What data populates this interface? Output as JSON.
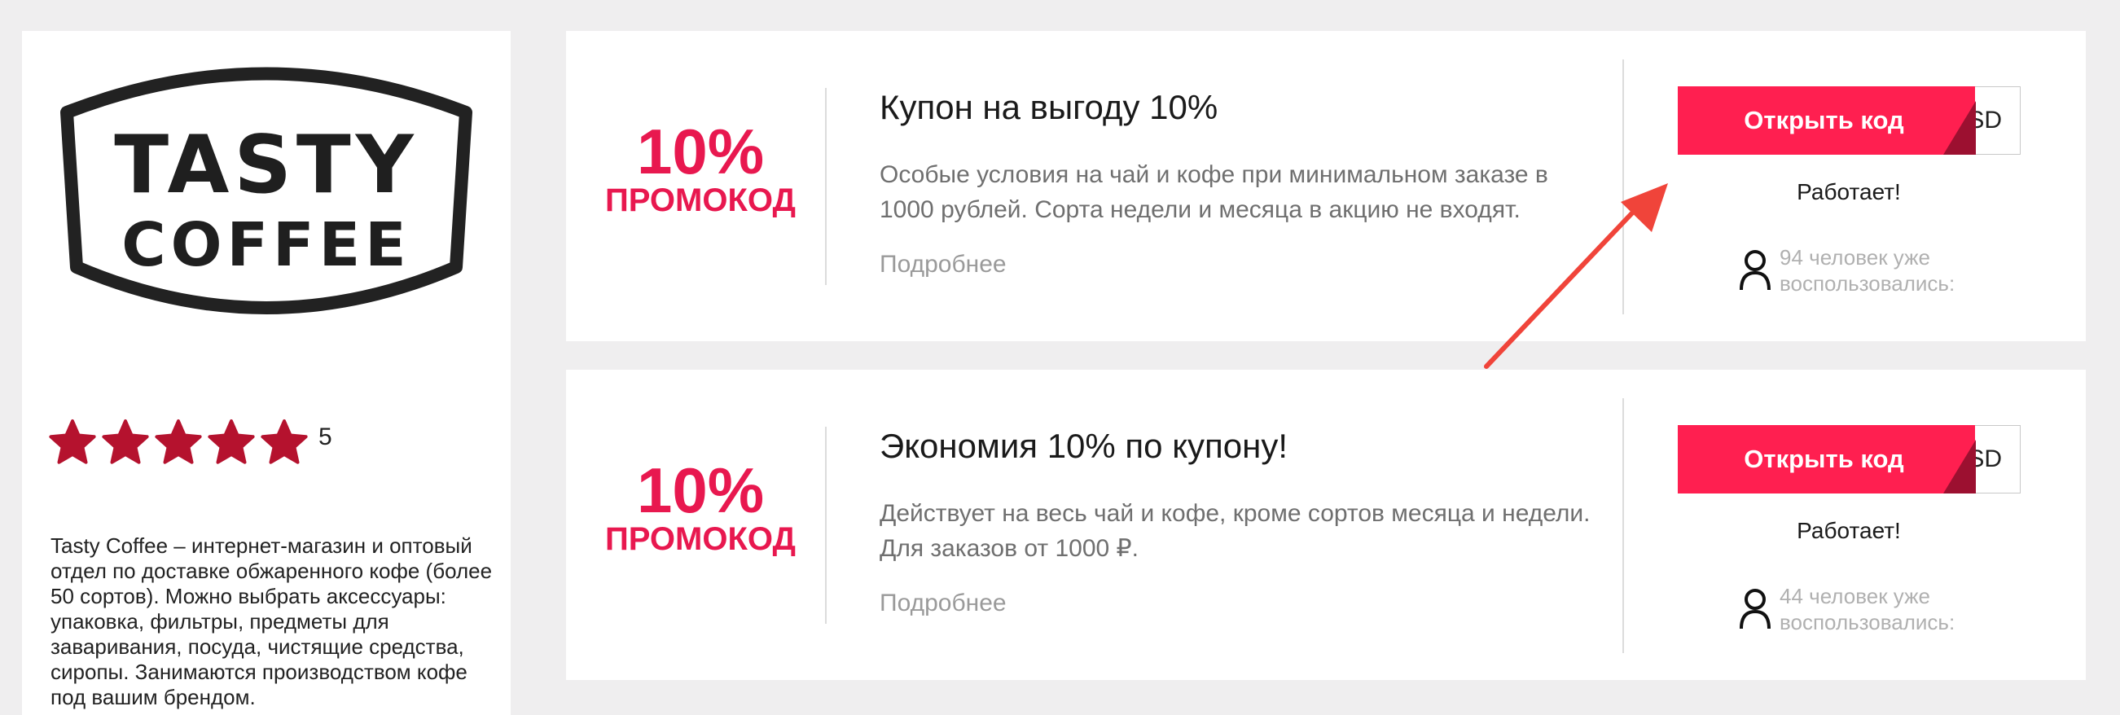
{
  "brand": {
    "logo_line1": "TASTY",
    "logo_line2": "COFFEE",
    "rating_value": "5",
    "rating_stars": 5,
    "description": "Tasty Coffee – интернет-магазин и оптовый отдел по доставке обжаренного кофе (более 50 сортов). Можно выбрать аксессуары: упаковка, фильтры, предметы для заваривания, посуда, чистящие средства, сиропы. Занимаются производством кофе под вашим брендом."
  },
  "icons": {
    "star": "star-icon",
    "user": "user-icon",
    "arrow": "arrow-annotation"
  },
  "colors": {
    "accent": "#e8184f",
    "button": "#ff1f50",
    "star": "#b5122e",
    "arrow": "#f0443a"
  },
  "coupons": [
    {
      "discount_value": "10%",
      "discount_type": "ПРОМОКОД",
      "title": "Купон на выгоду 10%",
      "description": "Особые условия на чай и кофе при минимальном заказе в 1000 рублей. Сорта недели и месяца в акцию не входят.",
      "more_label": "Подробнее",
      "code_peek": "SD",
      "button_label": "Открыть код",
      "status": "Работает!",
      "users_text": "94 человек уже воспользовались:"
    },
    {
      "discount_value": "10%",
      "discount_type": "ПРОМОКОД",
      "title": "Экономия 10% по купону!",
      "description": "Действует на весь чай и кофе, кроме сортов месяца и недели. Для заказов от 1000 ₽.",
      "more_label": "Подробнее",
      "code_peek": "SD",
      "button_label": "Открыть код",
      "status": "Работает!",
      "users_text": "44 человек уже воспользовались:"
    }
  ]
}
